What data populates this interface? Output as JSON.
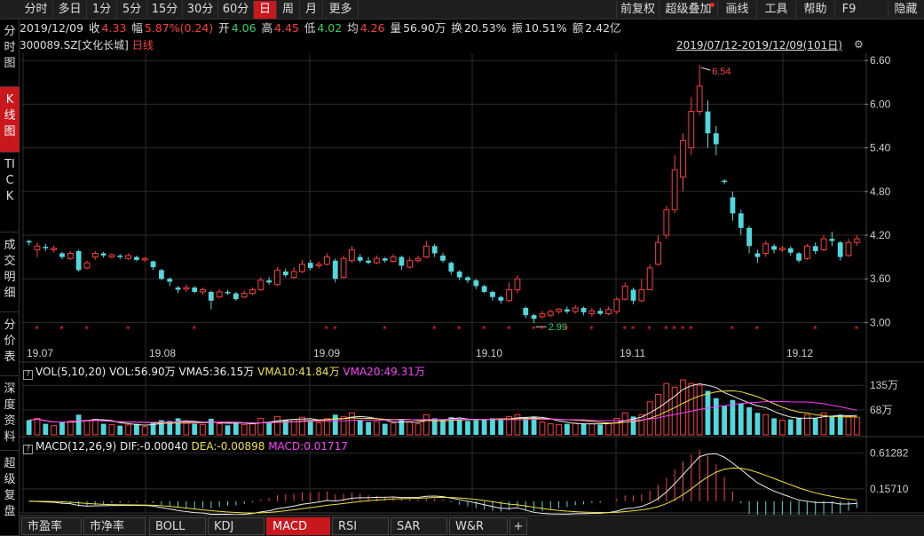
{
  "toolbar": {
    "periods": [
      "分时",
      "多日",
      "1分",
      "5分",
      "15分",
      "30分",
      "60分",
      "日",
      "周",
      "月",
      "更多"
    ],
    "active_period": "日",
    "right": [
      "前复权",
      "超级叠加",
      "画线",
      "工具",
      "帮助",
      "F9",
      "隐藏"
    ]
  },
  "sidebar": {
    "items": [
      "分时图",
      "K线图",
      "TICK",
      "成交明细",
      "分价表",
      "深度资料",
      "超级复盘"
    ],
    "active": "K线图"
  },
  "info": {
    "date": "2019/12/09",
    "close_label": "收",
    "close": "4.33",
    "change_label": "幅",
    "change": "5.87%(0.24)",
    "open_label": "开",
    "open": "4.06",
    "high_label": "高",
    "high": "4.45",
    "low_label": "低",
    "low": "4.02",
    "avg_label": "均",
    "avg": "4.26",
    "vol_label": "量",
    "vol": "56.90万",
    "turnover_label": "换",
    "turnover": "20.53%",
    "amp_label": "振",
    "amp": "10.51%",
    "amount_label": "额",
    "amount": "2.42亿"
  },
  "stock": {
    "code": "300089.SZ",
    "name": "[文化长城]",
    "period_tag": "日线",
    "range": "2019/07/12-2019/12/09(101日)",
    "max_label": "6.54",
    "min_label": "2.99"
  },
  "price_axis": [
    "6.60",
    "6.00",
    "5.40",
    "4.80",
    "4.20",
    "3.60",
    "3.00"
  ],
  "date_axis": [
    "19.07",
    "19.08",
    "19.09",
    "19.10",
    "19.11",
    "19.12"
  ],
  "vol_panel": {
    "title": "VOL(5,10,20)",
    "vol": "VOL:56.90万",
    "vma5": "VMA5:36.15万",
    "vma10": "VMA10:41.84万",
    "vma20": "VMA20:49.31万",
    "axis": [
      "135万",
      "68万"
    ]
  },
  "macd_panel": {
    "title": "MACD(12,26,9)",
    "dif": "DIF:-0.00040",
    "dea": "DEA:-0.00898",
    "macd": "MACD:0.01717",
    "axis": [
      "0.61282",
      "0.15710"
    ]
  },
  "tabs": [
    "市盈率",
    "市净率",
    "BOLL",
    "KDJ",
    "MACD",
    "RSI",
    "SAR",
    "W&R",
    "+"
  ],
  "active_tab": "MACD",
  "colors": {
    "up": "#ff3b3b",
    "down": "#4fd8dd",
    "accent": "#c8171d",
    "grid": "#2a2a2a"
  },
  "chart_data": {
    "type": "candlestick",
    "ylim": [
      2.7,
      6.7
    ],
    "vol_unit": "万",
    "candles": [
      [
        4.12,
        4.1,
        4.14,
        4.06,
        40
      ],
      [
        4.0,
        4.05,
        4.1,
        3.9,
        45
      ],
      [
        4.04,
        4.02,
        4.08,
        3.98,
        30
      ],
      [
        4.0,
        4.02,
        4.06,
        3.96,
        25
      ],
      [
        3.95,
        3.9,
        3.97,
        3.87,
        35
      ],
      [
        3.88,
        3.95,
        3.98,
        3.86,
        38
      ],
      [
        3.98,
        3.72,
        4.0,
        3.7,
        55
      ],
      [
        3.75,
        3.82,
        3.85,
        3.73,
        40
      ],
      [
        3.9,
        3.95,
        3.98,
        3.86,
        42
      ],
      [
        3.95,
        3.92,
        3.97,
        3.89,
        30
      ],
      [
        3.9,
        3.93,
        3.95,
        3.88,
        28
      ],
      [
        3.92,
        3.9,
        3.94,
        3.87,
        25
      ],
      [
        3.88,
        3.92,
        3.95,
        3.86,
        27
      ],
      [
        3.9,
        3.86,
        3.92,
        3.84,
        30
      ],
      [
        3.86,
        3.88,
        3.9,
        3.83,
        22
      ],
      [
        3.84,
        3.76,
        3.85,
        3.72,
        35
      ],
      [
        3.72,
        3.6,
        3.74,
        3.58,
        40
      ],
      [
        3.6,
        3.56,
        3.62,
        3.5,
        38
      ],
      [
        3.48,
        3.45,
        3.5,
        3.4,
        45
      ],
      [
        3.46,
        3.48,
        3.52,
        3.42,
        32
      ],
      [
        3.48,
        3.42,
        3.5,
        3.4,
        30
      ],
      [
        3.42,
        3.45,
        3.48,
        3.38,
        28
      ],
      [
        3.42,
        3.3,
        3.44,
        3.18,
        44
      ],
      [
        3.35,
        3.42,
        3.46,
        3.33,
        30
      ],
      [
        3.42,
        3.4,
        3.45,
        3.38,
        26
      ],
      [
        3.4,
        3.32,
        3.42,
        3.3,
        33
      ],
      [
        3.35,
        3.4,
        3.44,
        3.33,
        28
      ],
      [
        3.4,
        3.45,
        3.48,
        3.38,
        32
      ],
      [
        3.45,
        3.58,
        3.62,
        3.44,
        45
      ],
      [
        3.58,
        3.55,
        3.62,
        3.52,
        35
      ],
      [
        3.52,
        3.72,
        3.76,
        3.5,
        50
      ],
      [
        3.7,
        3.65,
        3.74,
        3.62,
        40
      ],
      [
        3.62,
        3.7,
        3.76,
        3.6,
        42
      ],
      [
        3.7,
        3.8,
        3.86,
        3.68,
        48
      ],
      [
        3.82,
        3.75,
        3.86,
        3.72,
        40
      ],
      [
        3.78,
        3.8,
        3.84,
        3.74,
        33
      ],
      [
        3.8,
        3.9,
        3.95,
        3.78,
        44
      ],
      [
        3.85,
        3.6,
        3.88,
        3.55,
        55
      ],
      [
        3.62,
        3.88,
        3.92,
        3.6,
        50
      ],
      [
        3.85,
        4.0,
        4.05,
        3.82,
        60
      ],
      [
        3.9,
        3.85,
        3.94,
        3.82,
        40
      ],
      [
        3.85,
        3.82,
        3.9,
        3.8,
        35
      ],
      [
        3.82,
        3.88,
        3.92,
        3.8,
        36
      ],
      [
        3.88,
        3.85,
        3.9,
        3.82,
        30
      ],
      [
        3.84,
        3.9,
        3.94,
        3.82,
        32
      ],
      [
        3.9,
        3.78,
        3.92,
        3.72,
        42
      ],
      [
        3.76,
        3.85,
        3.9,
        3.74,
        36
      ],
      [
        3.85,
        3.88,
        3.92,
        3.82,
        30
      ],
      [
        3.9,
        4.05,
        4.12,
        3.88,
        55
      ],
      [
        4.05,
        3.95,
        4.08,
        3.9,
        45
      ],
      [
        3.92,
        3.85,
        3.96,
        3.82,
        40
      ],
      [
        3.82,
        3.7,
        3.84,
        3.66,
        48
      ],
      [
        3.7,
        3.62,
        3.72,
        3.58,
        44
      ],
      [
        3.62,
        3.58,
        3.64,
        3.54,
        38
      ],
      [
        3.58,
        3.5,
        3.6,
        3.46,
        40
      ],
      [
        3.5,
        3.42,
        3.52,
        3.4,
        42
      ],
      [
        3.42,
        3.35,
        3.44,
        3.3,
        45
      ],
      [
        3.35,
        3.3,
        3.37,
        3.26,
        40
      ],
      [
        3.3,
        3.45,
        3.55,
        3.28,
        50
      ],
      [
        3.45,
        3.6,
        3.65,
        3.4,
        55
      ],
      [
        3.2,
        3.1,
        3.22,
        3.06,
        48
      ],
      [
        3.1,
        3.05,
        3.12,
        2.99,
        50
      ],
      [
        3.08,
        3.12,
        3.16,
        3.05,
        35
      ],
      [
        3.1,
        3.15,
        3.18,
        3.07,
        30
      ],
      [
        3.15,
        3.18,
        3.2,
        3.12,
        28
      ],
      [
        3.18,
        3.15,
        3.22,
        3.12,
        30
      ],
      [
        3.15,
        3.2,
        3.24,
        3.12,
        32
      ],
      [
        3.2,
        3.14,
        3.22,
        3.1,
        30
      ],
      [
        3.12,
        3.16,
        3.2,
        3.08,
        30
      ],
      [
        3.16,
        3.12,
        3.2,
        3.1,
        28
      ],
      [
        3.12,
        3.18,
        3.22,
        3.1,
        32
      ],
      [
        3.15,
        3.32,
        3.35,
        3.12,
        45
      ],
      [
        3.32,
        3.5,
        3.55,
        3.3,
        60
      ],
      [
        3.45,
        3.3,
        3.48,
        3.25,
        50
      ],
      [
        3.3,
        3.45,
        3.6,
        3.28,
        55
      ],
      [
        3.45,
        3.75,
        3.8,
        3.44,
        90
      ],
      [
        3.8,
        4.1,
        4.2,
        3.78,
        110
      ],
      [
        4.2,
        4.55,
        4.6,
        4.15,
        140
      ],
      [
        4.55,
        5.1,
        5.3,
        4.5,
        130
      ],
      [
        5.0,
        5.5,
        5.6,
        4.8,
        150
      ],
      [
        5.4,
        5.9,
        6.1,
        5.3,
        140
      ],
      [
        5.9,
        6.25,
        6.54,
        5.85,
        135
      ],
      [
        5.9,
        5.6,
        6.05,
        5.4,
        120
      ],
      [
        5.6,
        5.45,
        5.7,
        5.3,
        100
      ],
      [
        4.95,
        4.93,
        4.97,
        4.9,
        80
      ],
      [
        4.72,
        4.5,
        4.8,
        4.4,
        95
      ],
      [
        4.5,
        4.3,
        4.55,
        4.2,
        85
      ],
      [
        4.3,
        4.05,
        4.33,
        3.95,
        75
      ],
      [
        3.95,
        3.9,
        4.0,
        3.82,
        60
      ],
      [
        3.95,
        4.08,
        4.12,
        3.9,
        55
      ],
      [
        4.05,
        4.0,
        4.08,
        3.95,
        45
      ],
      [
        4.0,
        4.02,
        4.05,
        3.97,
        40
      ],
      [
        4.02,
        3.96,
        4.05,
        3.92,
        42
      ],
      [
        3.95,
        3.85,
        3.97,
        3.82,
        45
      ],
      [
        3.88,
        4.05,
        4.08,
        3.86,
        55
      ],
      [
        4.05,
        3.98,
        4.1,
        3.94,
        45
      ],
      [
        4.0,
        4.15,
        4.2,
        3.98,
        60
      ],
      [
        4.15,
        4.12,
        4.25,
        4.05,
        50
      ],
      [
        4.1,
        3.9,
        4.12,
        3.85,
        55
      ],
      [
        3.92,
        4.1,
        4.15,
        3.9,
        50
      ],
      [
        4.1,
        4.15,
        4.2,
        4.05,
        48
      ]
    ]
  }
}
